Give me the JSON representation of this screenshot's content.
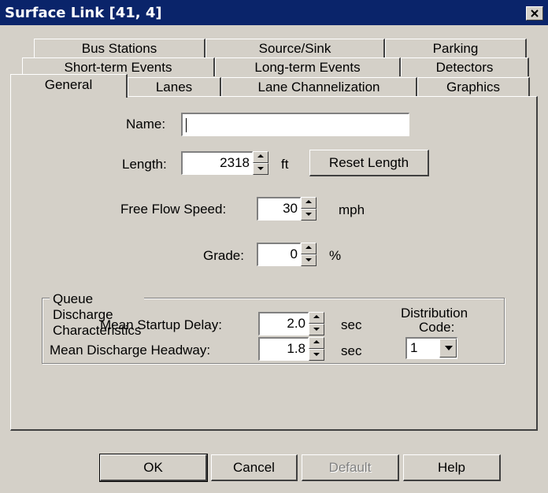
{
  "window": {
    "title": "Surface Link [41, 4]"
  },
  "tabs": {
    "row1": [
      "Bus Stations",
      "Source/Sink",
      "Parking"
    ],
    "row2": [
      "Short-term Events",
      "Long-term Events",
      "Detectors"
    ],
    "row3": [
      "General",
      "Lanes",
      "Lane Channelization",
      "Graphics"
    ],
    "active": "General"
  },
  "general": {
    "name_label": "Name:",
    "name_value": "",
    "length_label": "Length:",
    "length_value": "2318",
    "length_unit": "ft",
    "reset_length_label": "Reset Length",
    "free_flow_speed_label": "Free Flow Speed:",
    "free_flow_speed_value": "30",
    "free_flow_speed_unit": "mph",
    "grade_label": "Grade:",
    "grade_value": "0",
    "grade_unit": "%"
  },
  "queue": {
    "group_label": "Queue Discharge Characteristics",
    "startup_delay_label": "Mean Startup Delay:",
    "startup_delay_value": "2.0",
    "startup_delay_unit": "sec",
    "discharge_headway_label": "Mean Discharge Headway:",
    "discharge_headway_value": "1.8",
    "discharge_headway_unit": "sec",
    "distribution_label_line1": "Distribution",
    "distribution_label_line2": "Code:",
    "distribution_value": "1"
  },
  "buttons": {
    "ok": "OK",
    "cancel": "Cancel",
    "default": "Default",
    "help": "Help"
  }
}
